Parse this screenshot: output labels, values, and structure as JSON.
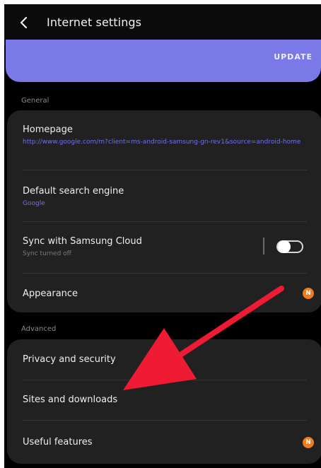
{
  "header": {
    "title": "Internet settings",
    "back_icon": "chevron-left-icon"
  },
  "banner": {
    "button_label": "UPDATE",
    "color": "#7b78e8"
  },
  "general": {
    "section_label": "General",
    "items": [
      {
        "title": "Homepage",
        "subtitle": "http://www.google.com/m?client=ms-android-samsung-gn-rev1&source=android-home"
      },
      {
        "title": "Default search engine",
        "subtitle": "Google"
      },
      {
        "title": "Sync with Samsung Cloud",
        "subtitle": "Sync turned off",
        "toggle": "off"
      },
      {
        "title": "Appearance",
        "badge": "N"
      }
    ]
  },
  "advanced": {
    "section_label": "Advanced",
    "items": [
      {
        "title": "Privacy and security"
      },
      {
        "title": "Sites and downloads"
      },
      {
        "title": "Useful features",
        "badge": "N"
      }
    ]
  },
  "colors": {
    "background": "#000000",
    "card": "#212121",
    "accent": "#6f72ea",
    "badge": "#f27b1c",
    "annotation_arrow": "#ef1a33"
  }
}
